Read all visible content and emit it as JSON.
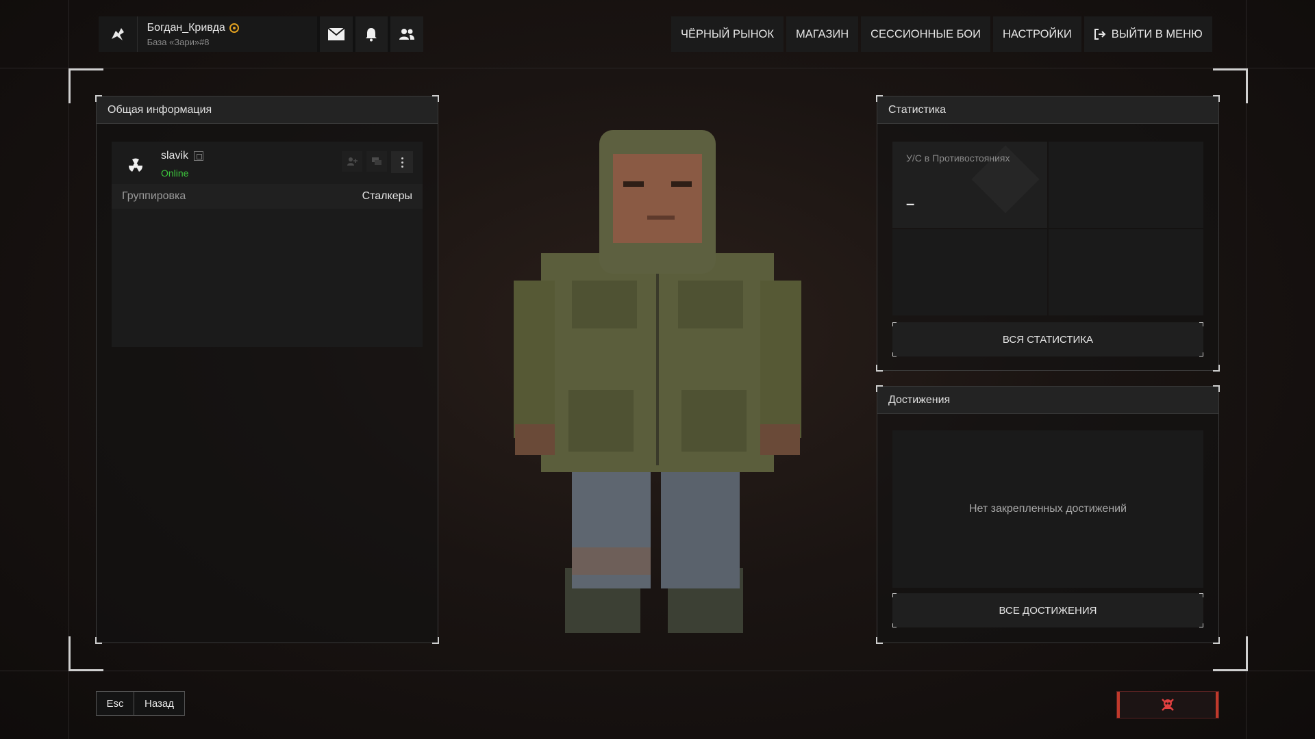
{
  "user": {
    "name": "Богдан_Кривда",
    "subtitle": "База «Зари»#8"
  },
  "nav": {
    "black_market": "ЧЁРНЫЙ РЫНОК",
    "shop": "МАГАЗИН",
    "session_battles": "СЕССИОННЫЕ БОИ",
    "settings": "НАСТРОЙКИ",
    "exit": "ВЫЙТИ В МЕНЮ"
  },
  "info_panel": {
    "title": "Общая информация",
    "player_name": "slavik",
    "status": "Online",
    "faction_label": "Группировка",
    "faction_value": "Сталкеры"
  },
  "stats_panel": {
    "title": "Статистика",
    "kd_label": "У/С в Противостояниях",
    "kd_value": "–",
    "all_button": "ВСЯ СТАТИСТИКА"
  },
  "achievements_panel": {
    "title": "Достижения",
    "empty_text": "Нет закрепленных достижений",
    "all_button": "ВСЕ ДОСТИЖЕНИЯ"
  },
  "footer": {
    "esc_key": "Esc",
    "back_label": "Назад"
  },
  "colors": {
    "accent_red": "#c0392b",
    "online_green": "#3cc43c",
    "badge_gold": "#e0a020"
  }
}
